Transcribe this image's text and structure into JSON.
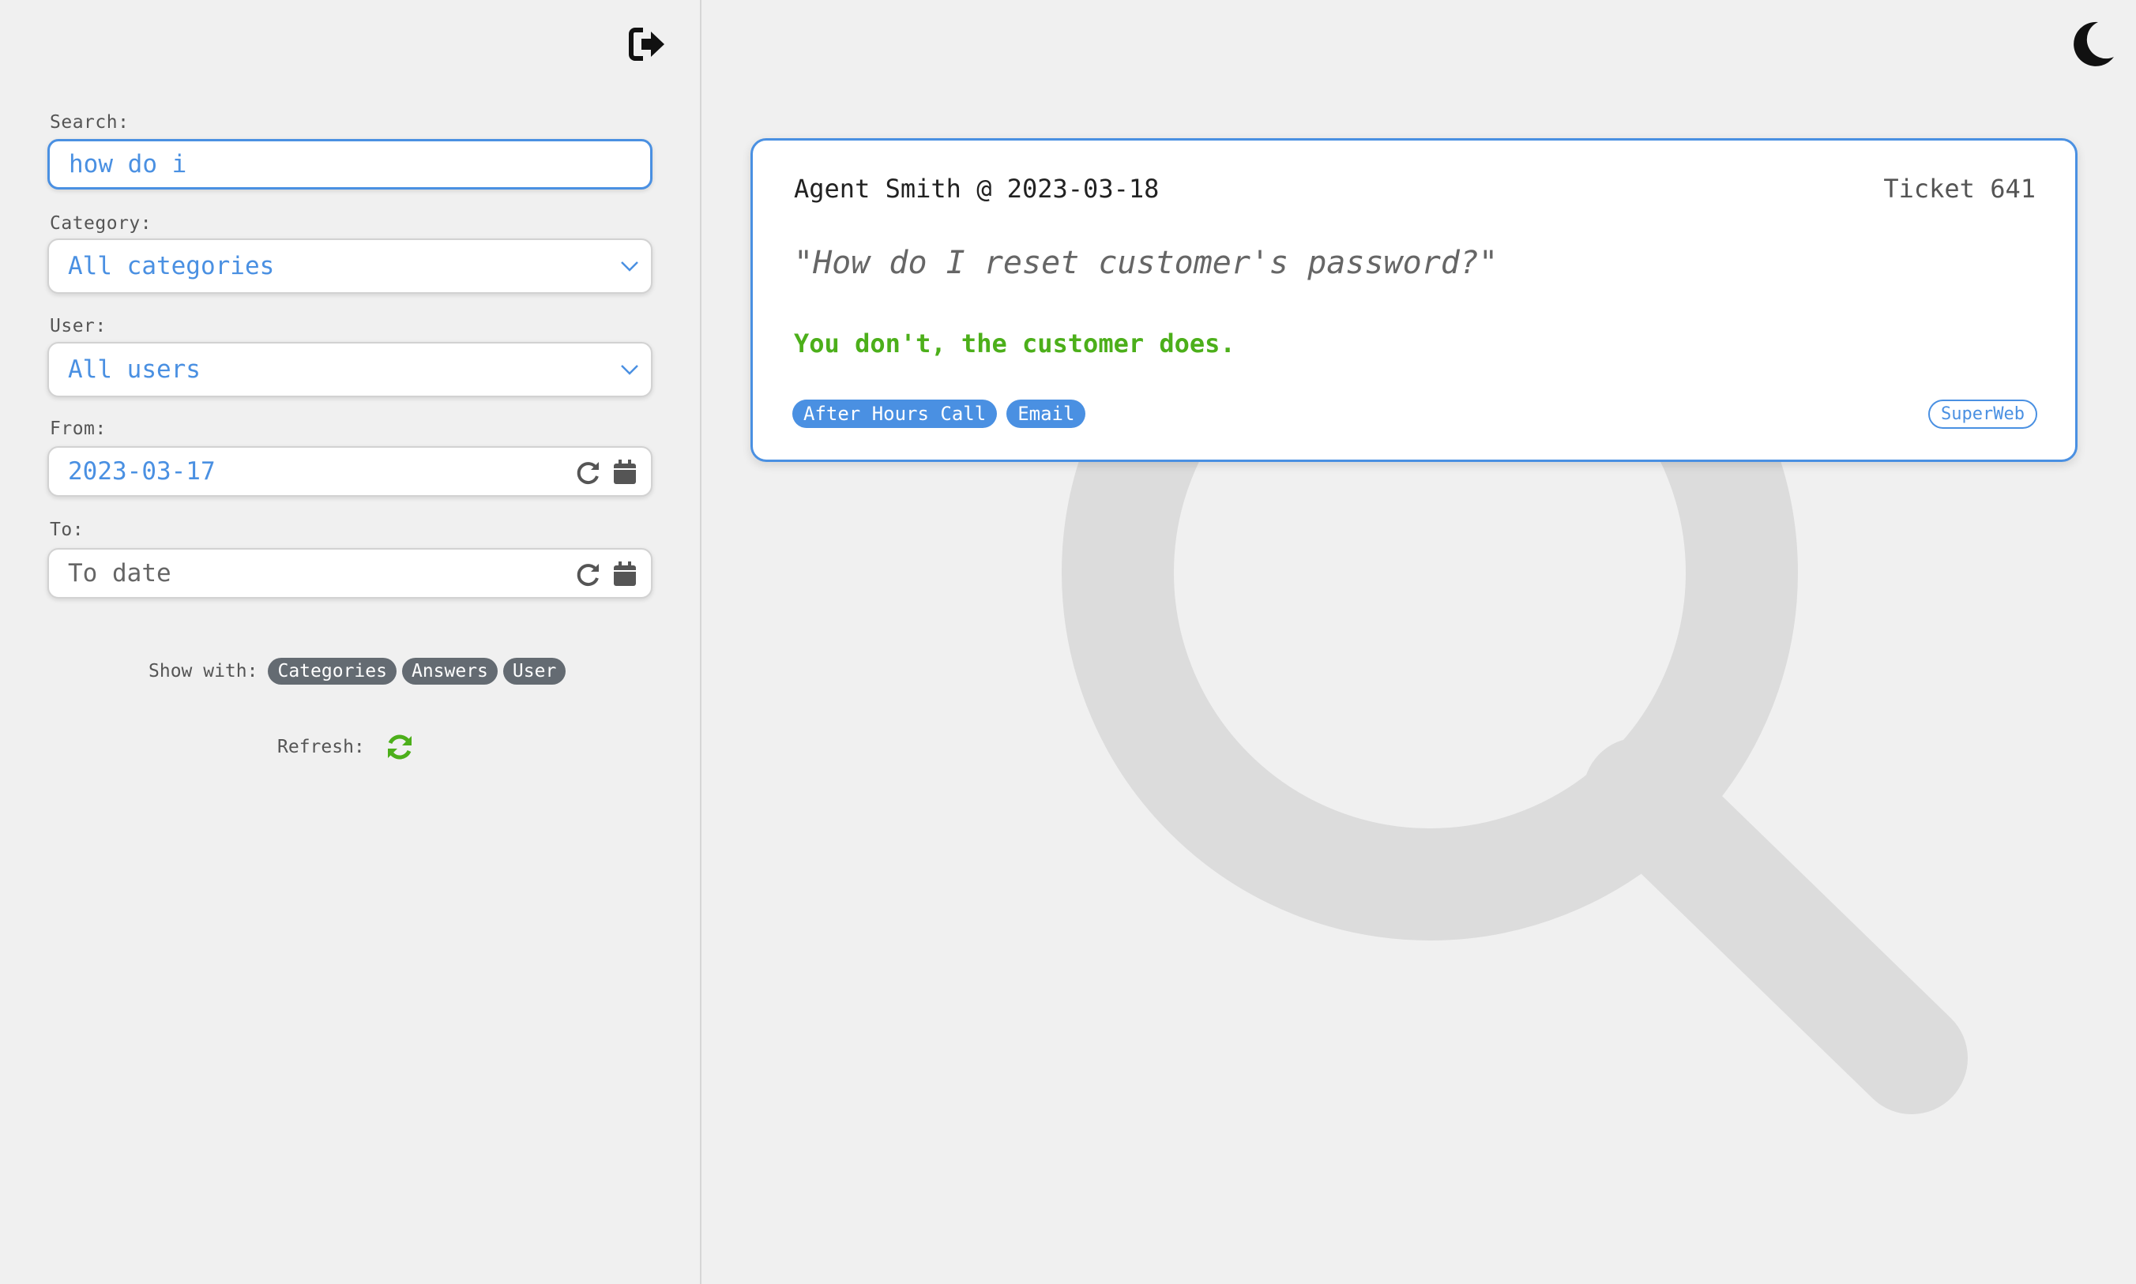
{
  "sidebar": {
    "search": {
      "label": "Search:",
      "value": "how do i"
    },
    "category": {
      "label": "Category:",
      "value": "All categories"
    },
    "user": {
      "label": "User:",
      "value": "All users"
    },
    "from": {
      "label": "From:",
      "value": "2023-03-17"
    },
    "to": {
      "label": "To:",
      "placeholder": "To date"
    },
    "show_with": {
      "label": "Show with:",
      "chips": [
        "Categories",
        "Answers",
        "User"
      ]
    },
    "refresh": {
      "label": "Refresh:"
    }
  },
  "result": {
    "author_line": "Agent Smith @ 2023-03-18",
    "ticket": "Ticket 641",
    "question": "\"How do I reset customer's password?\"",
    "answer": "You don't, the customer does.",
    "tags": [
      "After Hours Call",
      "Email"
    ],
    "company": "SuperWeb"
  },
  "colors": {
    "accent": "#4a90e2",
    "answer_green": "#4caf1a",
    "chip_gray": "#646b72",
    "background": "#f0f0f0"
  },
  "icons": {
    "logout": "logout-icon",
    "theme": "moon-icon",
    "select": "chevron-down-icon",
    "reset": "reset-icon",
    "calendar": "calendar-icon",
    "refresh": "refresh-icon",
    "background": "search-icon"
  }
}
